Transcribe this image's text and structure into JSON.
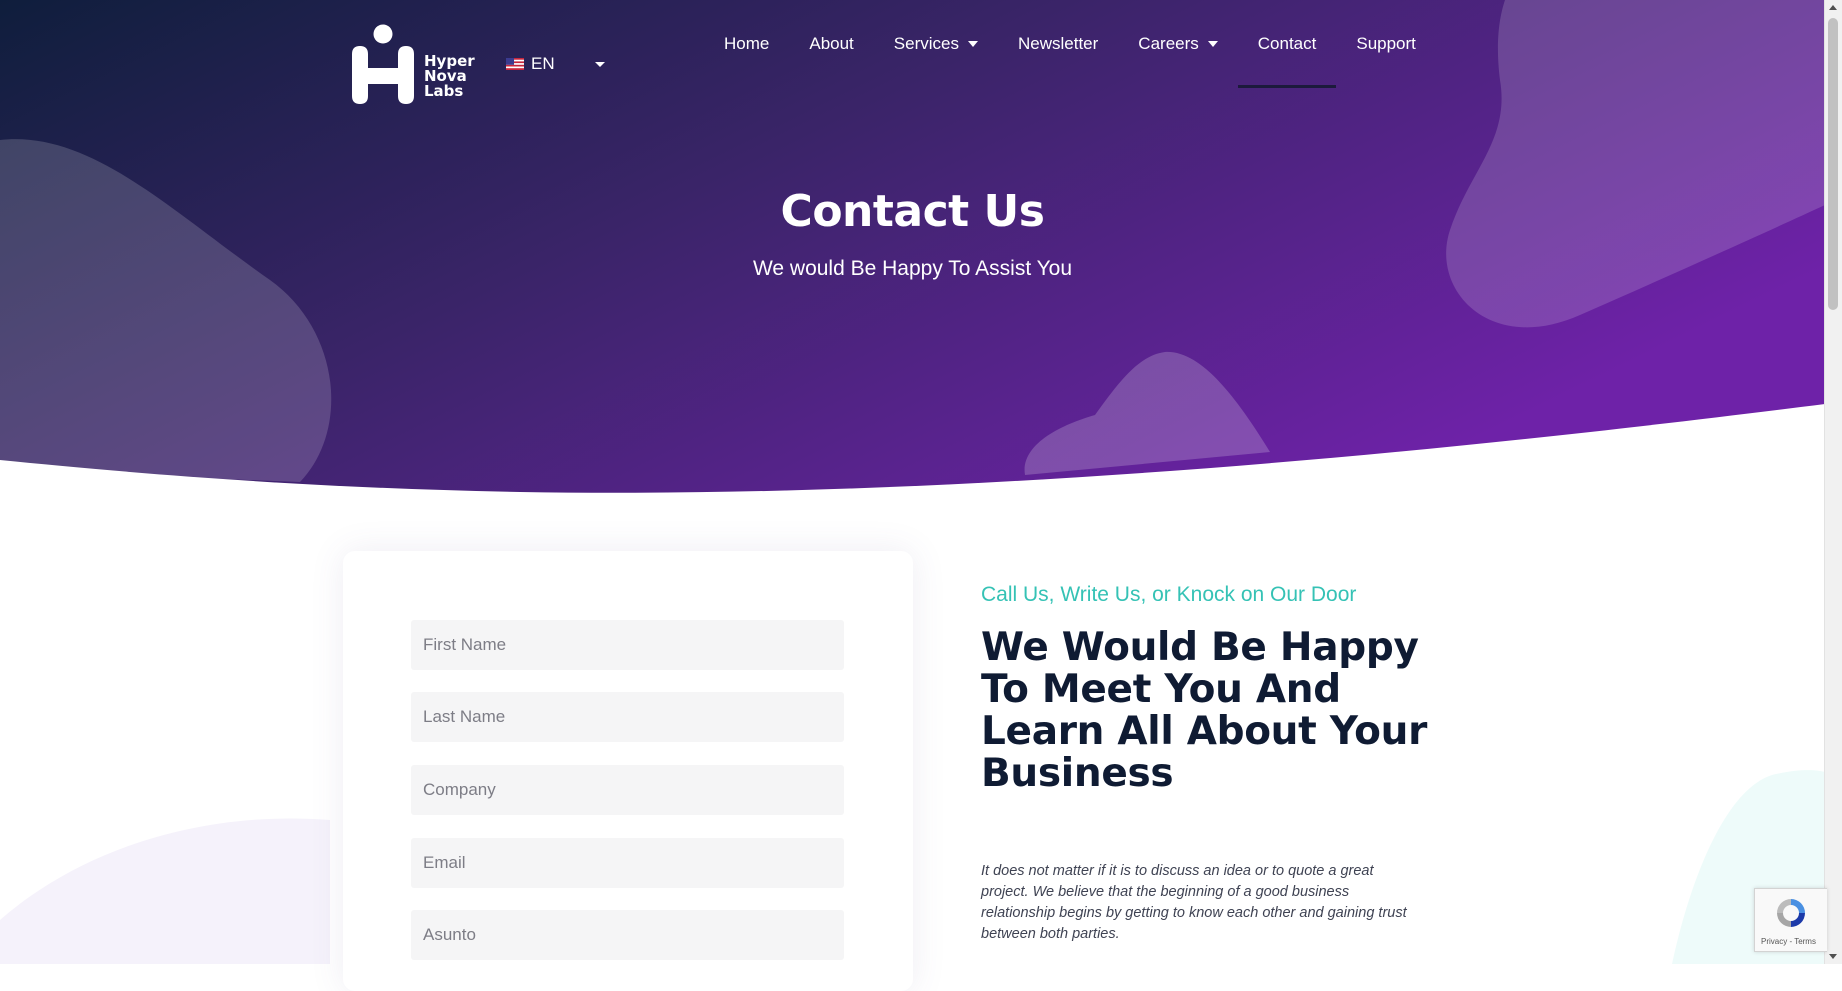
{
  "brand": {
    "name_line1": "Hyper",
    "name_line2": "Nova",
    "name_line3": "Labs"
  },
  "language": {
    "current": "EN",
    "flag": "us-flag-icon"
  },
  "nav": {
    "home": "Home",
    "about": "About",
    "services": "Services",
    "newsletter": "Newsletter",
    "careers": "Careers",
    "contact": "Contact",
    "support": "Support",
    "active": "Contact"
  },
  "hero": {
    "title": "Contact Us",
    "subtitle": "We would Be Happy To Assist You"
  },
  "form": {
    "first_name_placeholder": "First Name",
    "last_name_placeholder": "Last Name",
    "company_placeholder": "Company",
    "email_placeholder": "Email",
    "subject_placeholder": "Asunto"
  },
  "content": {
    "tagline": "Call Us, Write Us, or Knock on Our Door",
    "heading": "We Would Be Happy To Meet You And Learn All About Your Business",
    "body": "It does not matter if it is to discuss an idea or to quote a great project. We believe that the beginning of a good business relationship begins by getting to know each other and gaining trust between both parties."
  },
  "recaptcha": {
    "links": "Privacy - Terms"
  },
  "colors": {
    "hero_gradient_start": "#0f1e3c",
    "hero_gradient_mid": "#3a2468",
    "hero_gradient_end": "#6e22a8",
    "accent_teal": "#35c2b5",
    "heading_dark": "#0f1b33"
  }
}
